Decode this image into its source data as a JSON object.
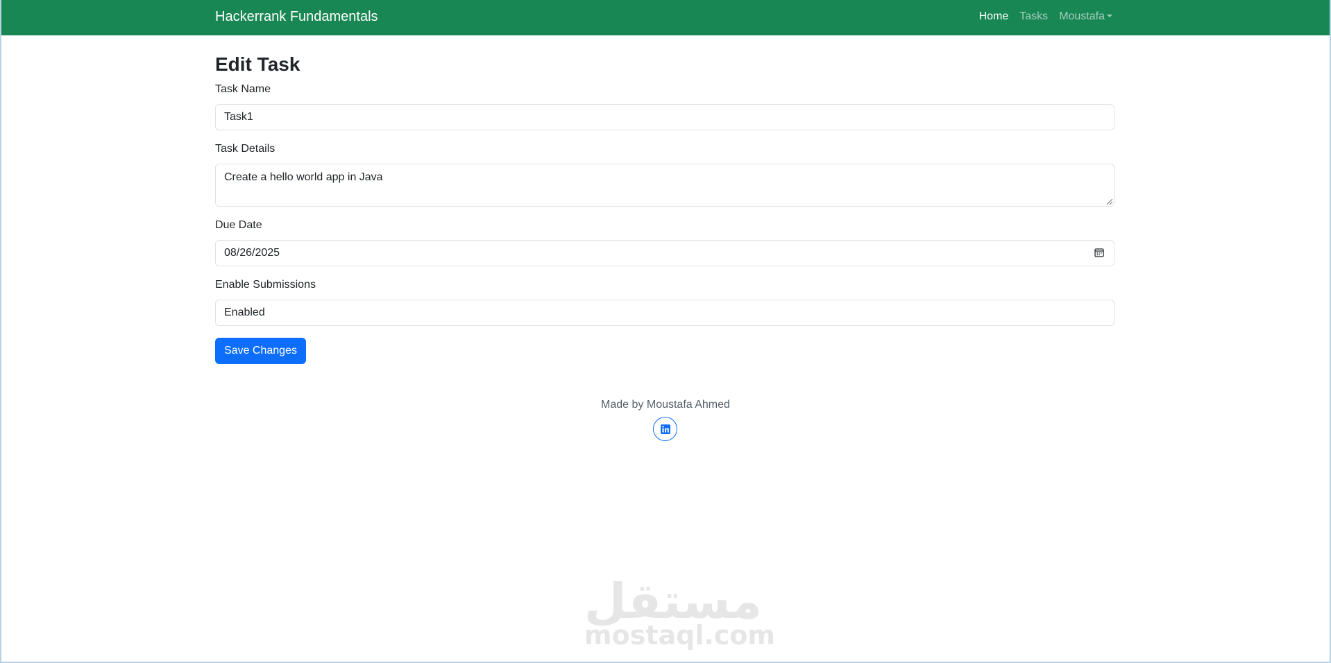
{
  "navbar": {
    "brand": "Hackerrank Fundamentals",
    "links": [
      {
        "label": "Home"
      },
      {
        "label": "Tasks"
      },
      {
        "label": "Moustafa"
      }
    ]
  },
  "page": {
    "title": "Edit Task"
  },
  "form": {
    "task_name": {
      "label": "Task Name",
      "value": "Task1"
    },
    "task_details": {
      "label": "Task Details",
      "value": "Create a hello world app in Java"
    },
    "due_date": {
      "label": "Due Date",
      "value": "08/26/2025"
    },
    "enable_submissions": {
      "label": "Enable Submissions",
      "value": "Enabled"
    },
    "submit_label": "Save Changes"
  },
  "footer": {
    "text": "Made by Moustafa Ahmed"
  },
  "watermark": {
    "arabic": "مستقل",
    "latin": "mostaql.com"
  },
  "colors": {
    "navbar": "#198754",
    "primary": "#0d6efd"
  },
  "icons": [
    "calendar-icon",
    "linkedin-icon",
    "caret-down-icon"
  ]
}
